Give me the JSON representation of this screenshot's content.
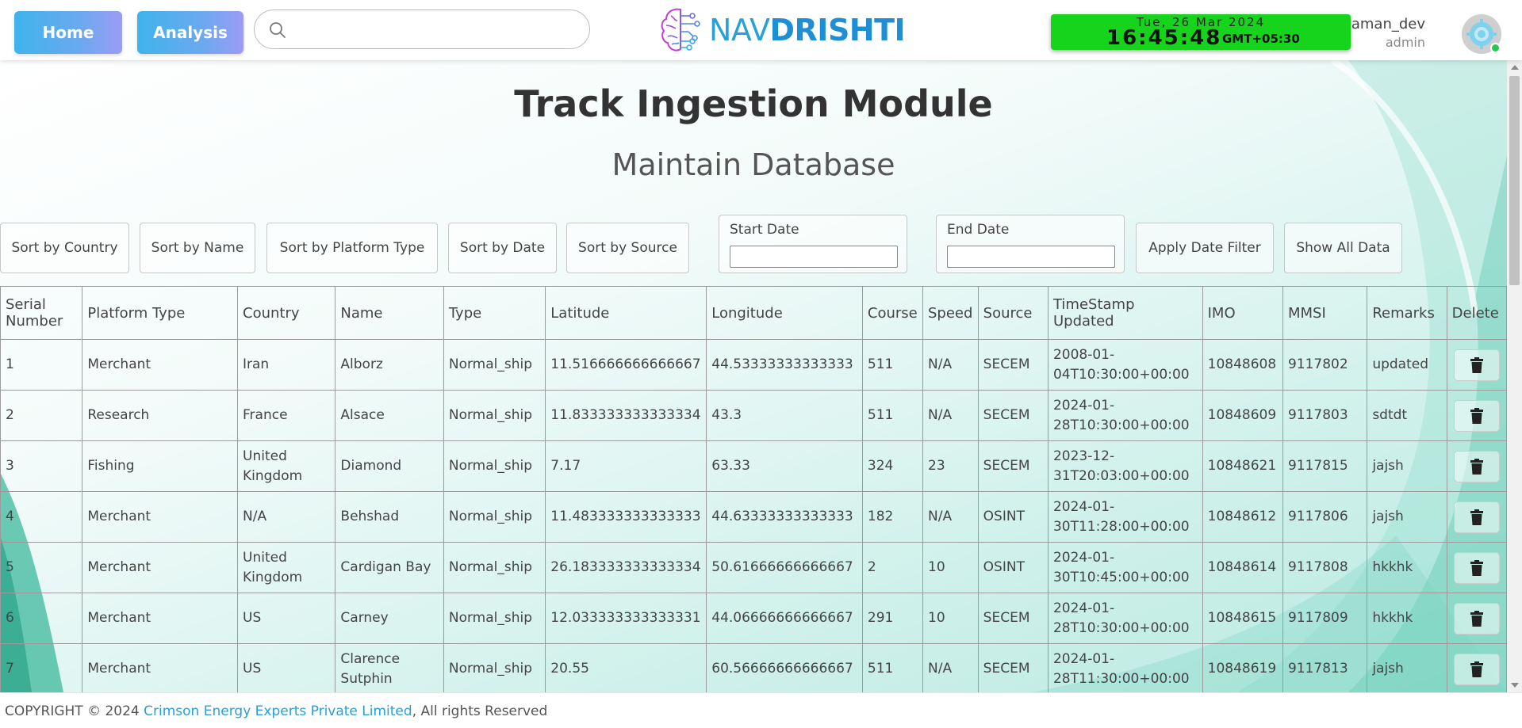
{
  "header": {
    "home_label": "Home",
    "analysis_label": "Analysis",
    "search_placeholder": "",
    "logo_nav": "NAV",
    "logo_drishti": "DRISHTI",
    "clock_date": "Tue, 26 Mar 2024",
    "clock_time": "16:45:48",
    "clock_tz": "GMT+05:30",
    "username": "aman_dev",
    "role": "admin"
  },
  "page": {
    "title": "Track Ingestion Module",
    "subtitle": "Maintain Database"
  },
  "controls": {
    "sort_country": "Sort by Country",
    "sort_name": "Sort by Name",
    "sort_platform": "Sort by Platform Type",
    "sort_date": "Sort by Date",
    "sort_source": "Sort by Source",
    "start_date_label": "Start Date",
    "start_date_value": "",
    "end_date_label": "End Date",
    "end_date_value": "",
    "apply_filter": "Apply Date Filter",
    "show_all": "Show All Data"
  },
  "table": {
    "headers": [
      "Serial Number",
      "Platform Type",
      "Country",
      "Name",
      "Type",
      "Latitude",
      "Longitude",
      "Course",
      "Speed",
      "Source",
      "TimeStamp Updated",
      "IMO",
      "MMSI",
      "Remarks",
      "Delete"
    ],
    "rows": [
      [
        "1",
        "Merchant",
        "Iran",
        "Alborz",
        "Normal_ship",
        "11.516666666666667",
        "44.53333333333333",
        "511",
        "N/A",
        "SECEM",
        "2008-01-04T10:30:00+00:00",
        "10848608",
        "9117802",
        "updated"
      ],
      [
        "2",
        "Research",
        "France",
        "Alsace",
        "Normal_ship",
        "11.833333333333334",
        "43.3",
        "511",
        "N/A",
        "SECEM",
        "2024-01-28T10:30:00+00:00",
        "10848609",
        "9117803",
        "sdtdt"
      ],
      [
        "3",
        "Fishing",
        "United Kingdom",
        "Diamond",
        "Normal_ship",
        "7.17",
        "63.33",
        "324",
        "23",
        "SECEM",
        "2023-12-31T20:03:00+00:00",
        "10848621",
        "9117815",
        "jajsh"
      ],
      [
        "4",
        "Merchant",
        "N/A",
        "Behshad",
        "Normal_ship",
        "11.483333333333333",
        "44.63333333333333",
        "182",
        "N/A",
        "OSINT",
        "2024-01-30T11:28:00+00:00",
        "10848612",
        "9117806",
        "jajsh"
      ],
      [
        "5",
        "Merchant",
        "United Kingdom",
        "Cardigan Bay",
        "Normal_ship",
        "26.183333333333334",
        "50.61666666666667",
        "2",
        "10",
        "OSINT",
        "2024-01-30T10:45:00+00:00",
        "10848614",
        "9117808",
        "hkkhk"
      ],
      [
        "6",
        "Merchant",
        "US",
        "Carney",
        "Normal_ship",
        "12.033333333333331",
        "44.06666666666667",
        "291",
        "10",
        "SECEM",
        "2024-01-28T10:30:00+00:00",
        "10848615",
        "9117809",
        "hkkhk"
      ],
      [
        "7",
        "Merchant",
        "US",
        "Clarence Sutphin",
        "Normal_ship",
        "20.55",
        "60.56666666666667",
        "511",
        "N/A",
        "SECEM",
        "2024-01-28T11:30:00+00:00",
        "10848619",
        "9117813",
        "jajsh"
      ]
    ]
  },
  "footer": {
    "prefix": "COPYRIGHT © 2024 ",
    "company": "Crimson Energy Experts Private Limited",
    "suffix": ", All rights Reserved"
  },
  "colors": {
    "nav_button_gradient_start": "#3fb3ec",
    "nav_button_gradient_end": "#9b9cf5",
    "clock_bg": "#15d41b",
    "brand_blue": "#1e8fd4",
    "teal_background": "#b6e9df",
    "link": "#2a9fd6"
  },
  "icons": {
    "search": "search-icon",
    "logo": "brain-circuit-icon",
    "avatar": "avatar-gear-icon",
    "delete": "trash-icon"
  }
}
